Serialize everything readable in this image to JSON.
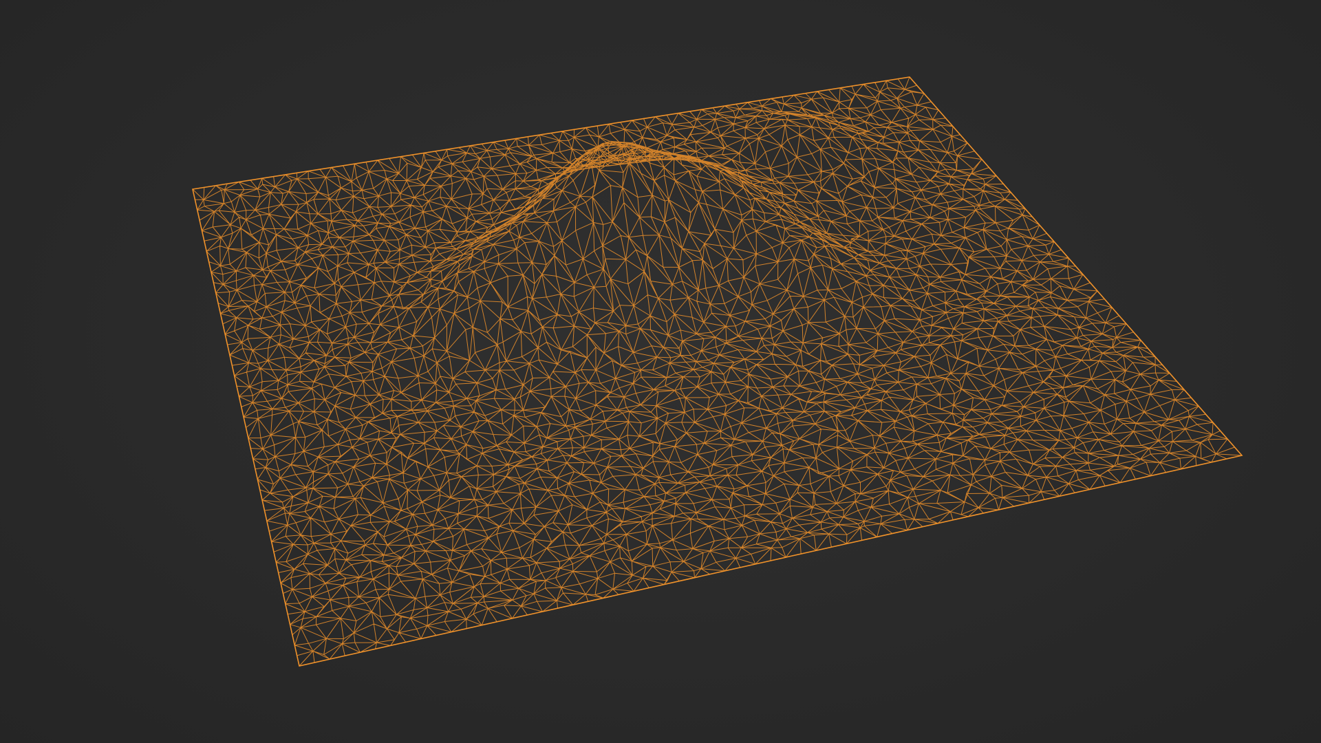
{
  "scene": {
    "background_color": "#2a2a2a",
    "wire_color": "#f0922a",
    "wire_color_dim": "#c9761f",
    "object": "terrain-wireframe-mesh",
    "icons": []
  }
}
